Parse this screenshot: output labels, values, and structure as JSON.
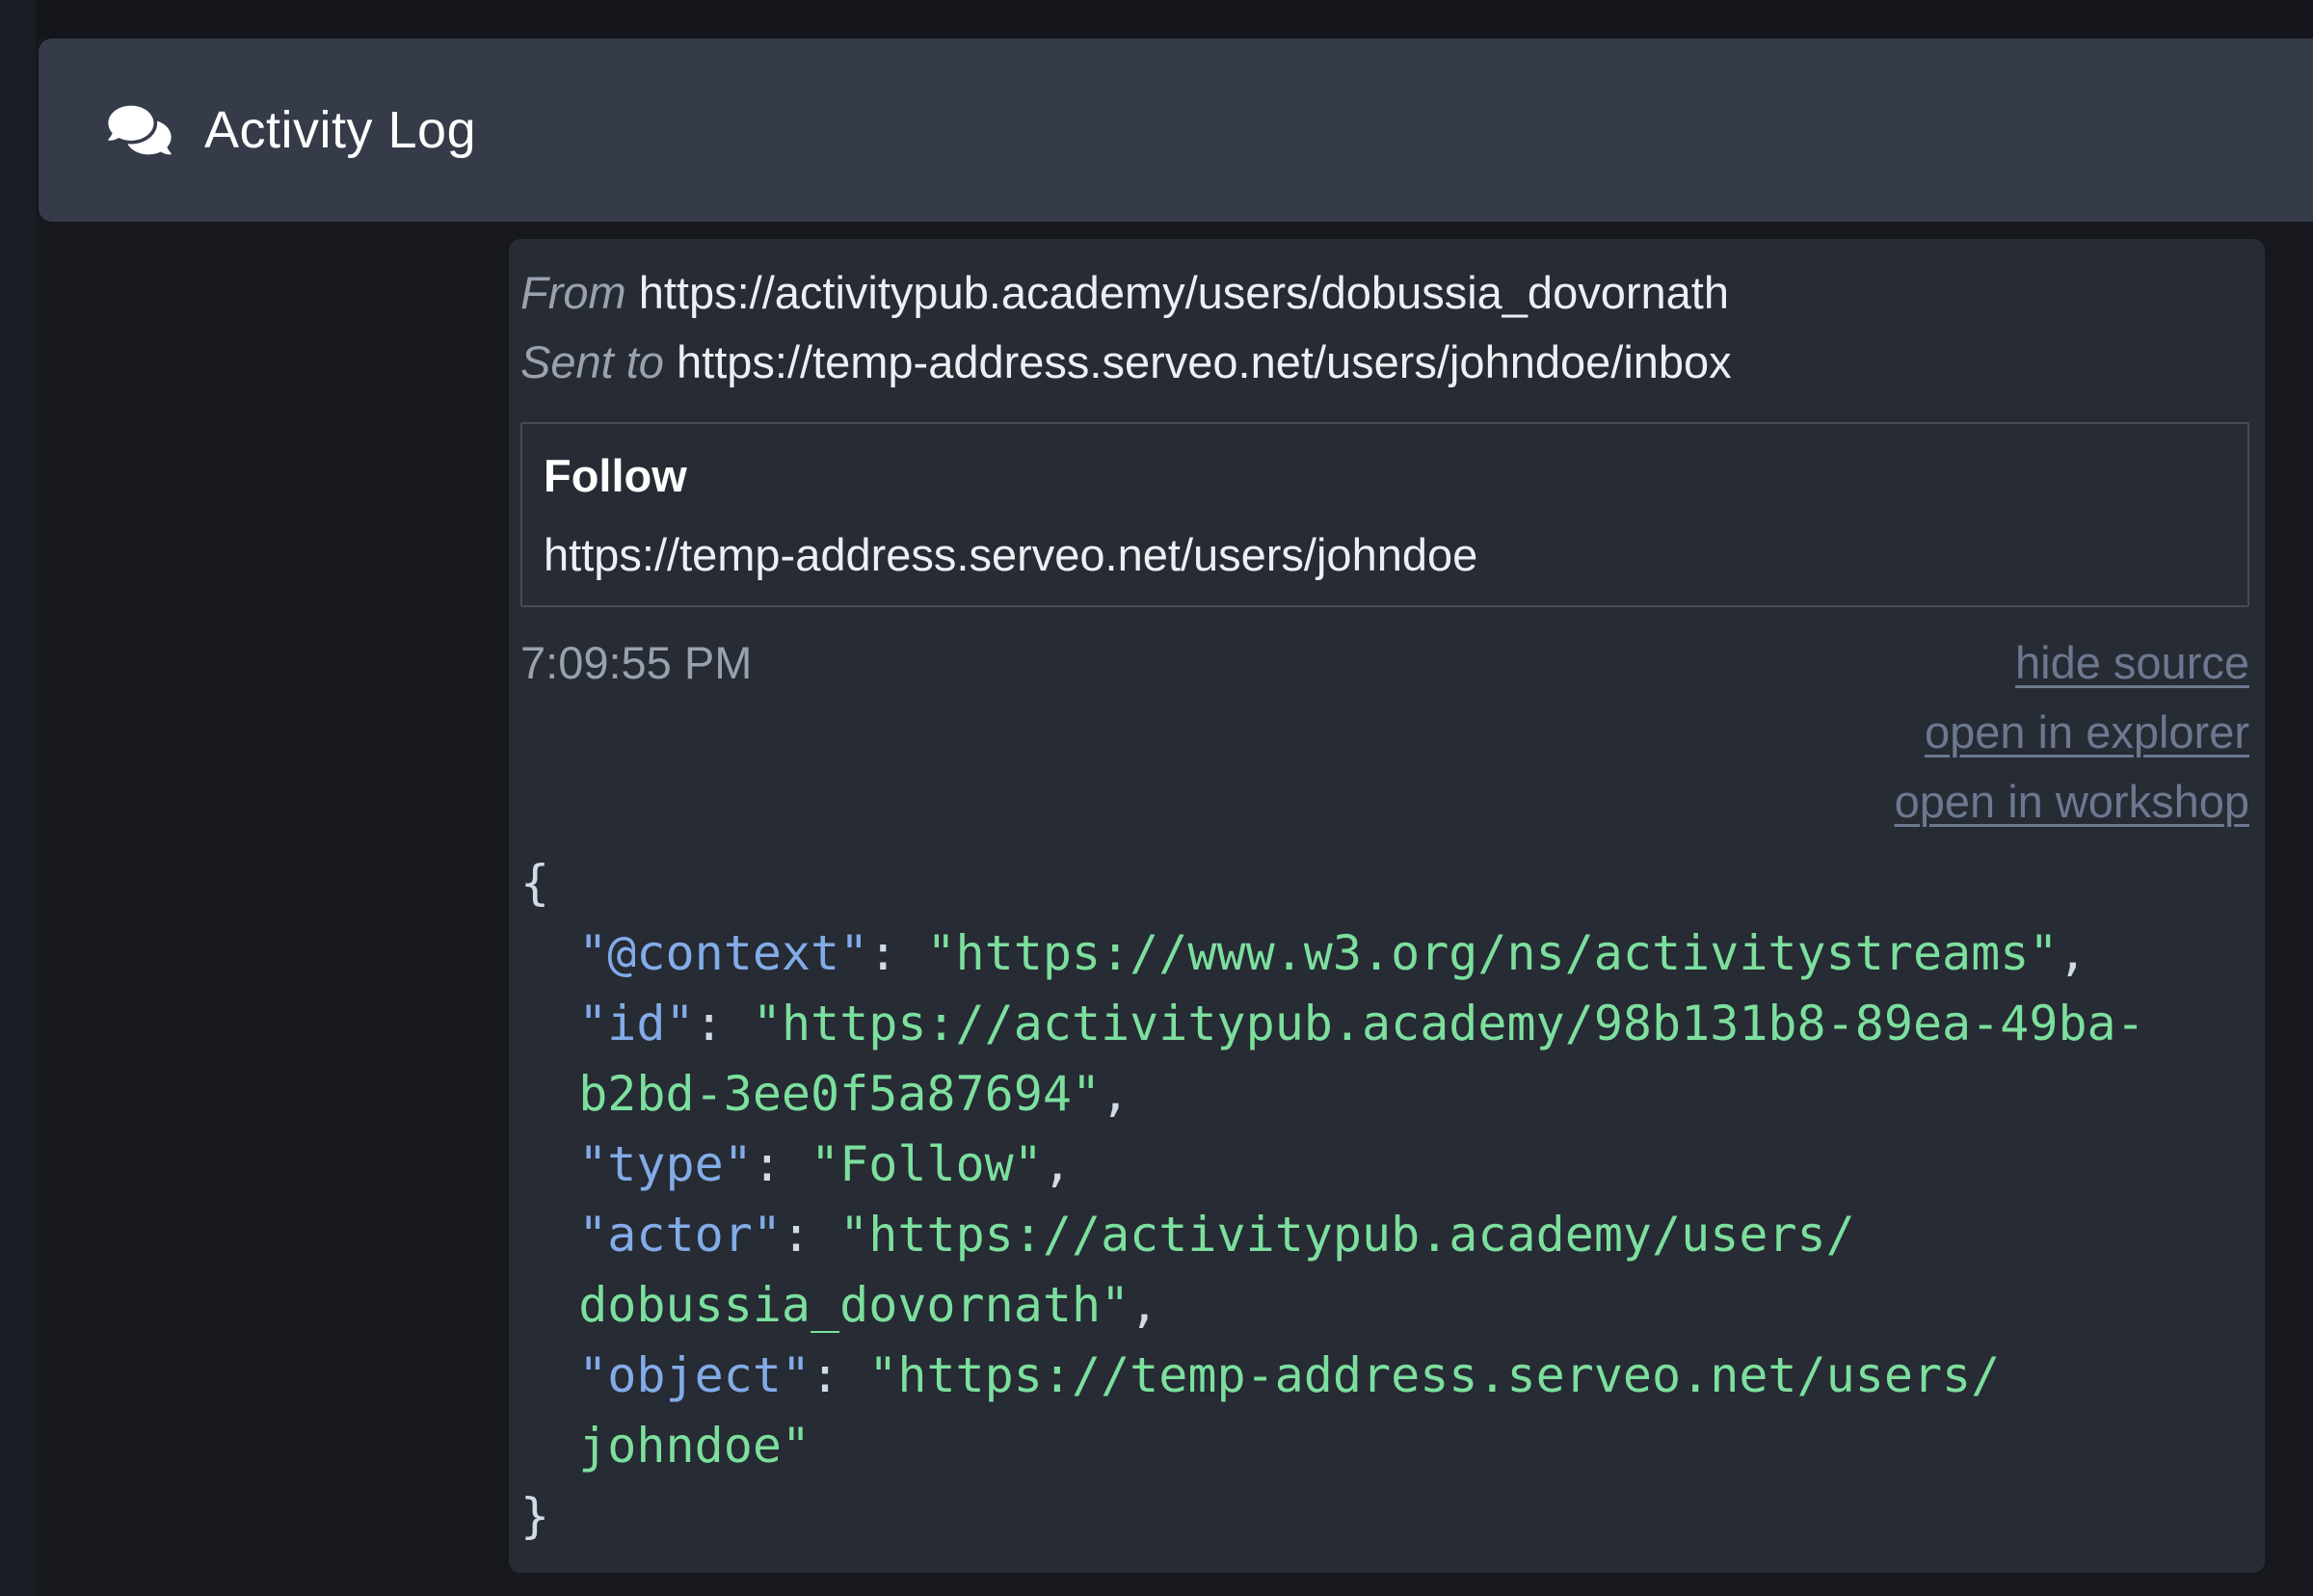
{
  "colors": {
    "page_bg": "#16181e",
    "header_bg": "#353b49",
    "card_bg": "#262b34",
    "muted_text": "#99a1af",
    "accent_link": "#6d7890",
    "json_key": "#83abe8",
    "json_string": "#7cdf9d",
    "json_punct": "#d3dae7"
  },
  "header": {
    "icon": "comments-icon",
    "title": "Activity Log"
  },
  "entry": {
    "from_label": "From",
    "from_value": "https://activitypub.academy/users/dobussia_dovornath",
    "sent_to_label": "Sent to",
    "sent_to_value": "https://temp-address.serveo.net/users/johndoe/inbox",
    "activity": {
      "type": "Follow",
      "object": "https://temp-address.serveo.net/users/johndoe"
    },
    "timestamp": "7:09:55 PM",
    "links": [
      {
        "label": "hide source"
      },
      {
        "label": "open in explorer"
      },
      {
        "label": "open in workshop"
      }
    ],
    "source_json": {
      "lines": [
        [
          [
            "p",
            "{"
          ]
        ],
        [
          [
            "k",
            "  \"@context\""
          ],
          [
            "p",
            ": "
          ],
          [
            "s",
            "\"https://www.w3.org/ns/activitystreams\""
          ],
          [
            "p",
            ","
          ]
        ],
        [
          [
            "k",
            "  \"id\""
          ],
          [
            "p",
            ": "
          ],
          [
            "s",
            "\"https://activitypub.academy/98b131b8-89ea-49ba-"
          ]
        ],
        [
          [
            "s",
            "  b2bd-3ee0f5a87694\""
          ],
          [
            "p",
            ","
          ]
        ],
        [
          [
            "k",
            "  \"type\""
          ],
          [
            "p",
            ": "
          ],
          [
            "s",
            "\"Follow\""
          ],
          [
            "p",
            ","
          ]
        ],
        [
          [
            "k",
            "  \"actor\""
          ],
          [
            "p",
            ": "
          ],
          [
            "s",
            "\"https://activitypub.academy/users/"
          ]
        ],
        [
          [
            "s",
            "  dobussia_dovornath\""
          ],
          [
            "p",
            ","
          ]
        ],
        [
          [
            "k",
            "  \"object\""
          ],
          [
            "p",
            ": "
          ],
          [
            "s",
            "\"https://temp-address.serveo.net/users/"
          ]
        ],
        [
          [
            "s",
            "  johndoe\""
          ]
        ],
        [
          [
            "p",
            "}"
          ]
        ]
      ]
    }
  }
}
